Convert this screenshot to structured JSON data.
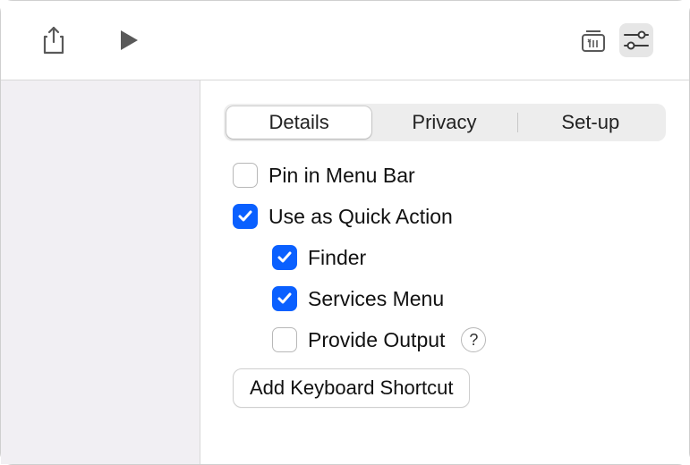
{
  "toolbar": {
    "left": [
      {
        "name": "share-icon"
      },
      {
        "name": "play-icon"
      }
    ],
    "right": [
      {
        "name": "library-icon",
        "selected": false
      },
      {
        "name": "settings-icon",
        "selected": true
      }
    ]
  },
  "tabs": {
    "items": [
      {
        "label": "Details",
        "active": true
      },
      {
        "label": "Privacy",
        "active": false
      },
      {
        "label": "Set-up",
        "active": false
      }
    ]
  },
  "options": {
    "pin_in_menu_bar": {
      "label": "Pin in Menu Bar",
      "checked": false
    },
    "use_as_quick_action": {
      "label": "Use as Quick Action",
      "checked": true
    },
    "finder": {
      "label": "Finder",
      "checked": true
    },
    "services_menu": {
      "label": "Services Menu",
      "checked": true
    },
    "provide_output": {
      "label": "Provide Output",
      "checked": false
    }
  },
  "buttons": {
    "add_keyboard_shortcut": "Add Keyboard Shortcut"
  }
}
